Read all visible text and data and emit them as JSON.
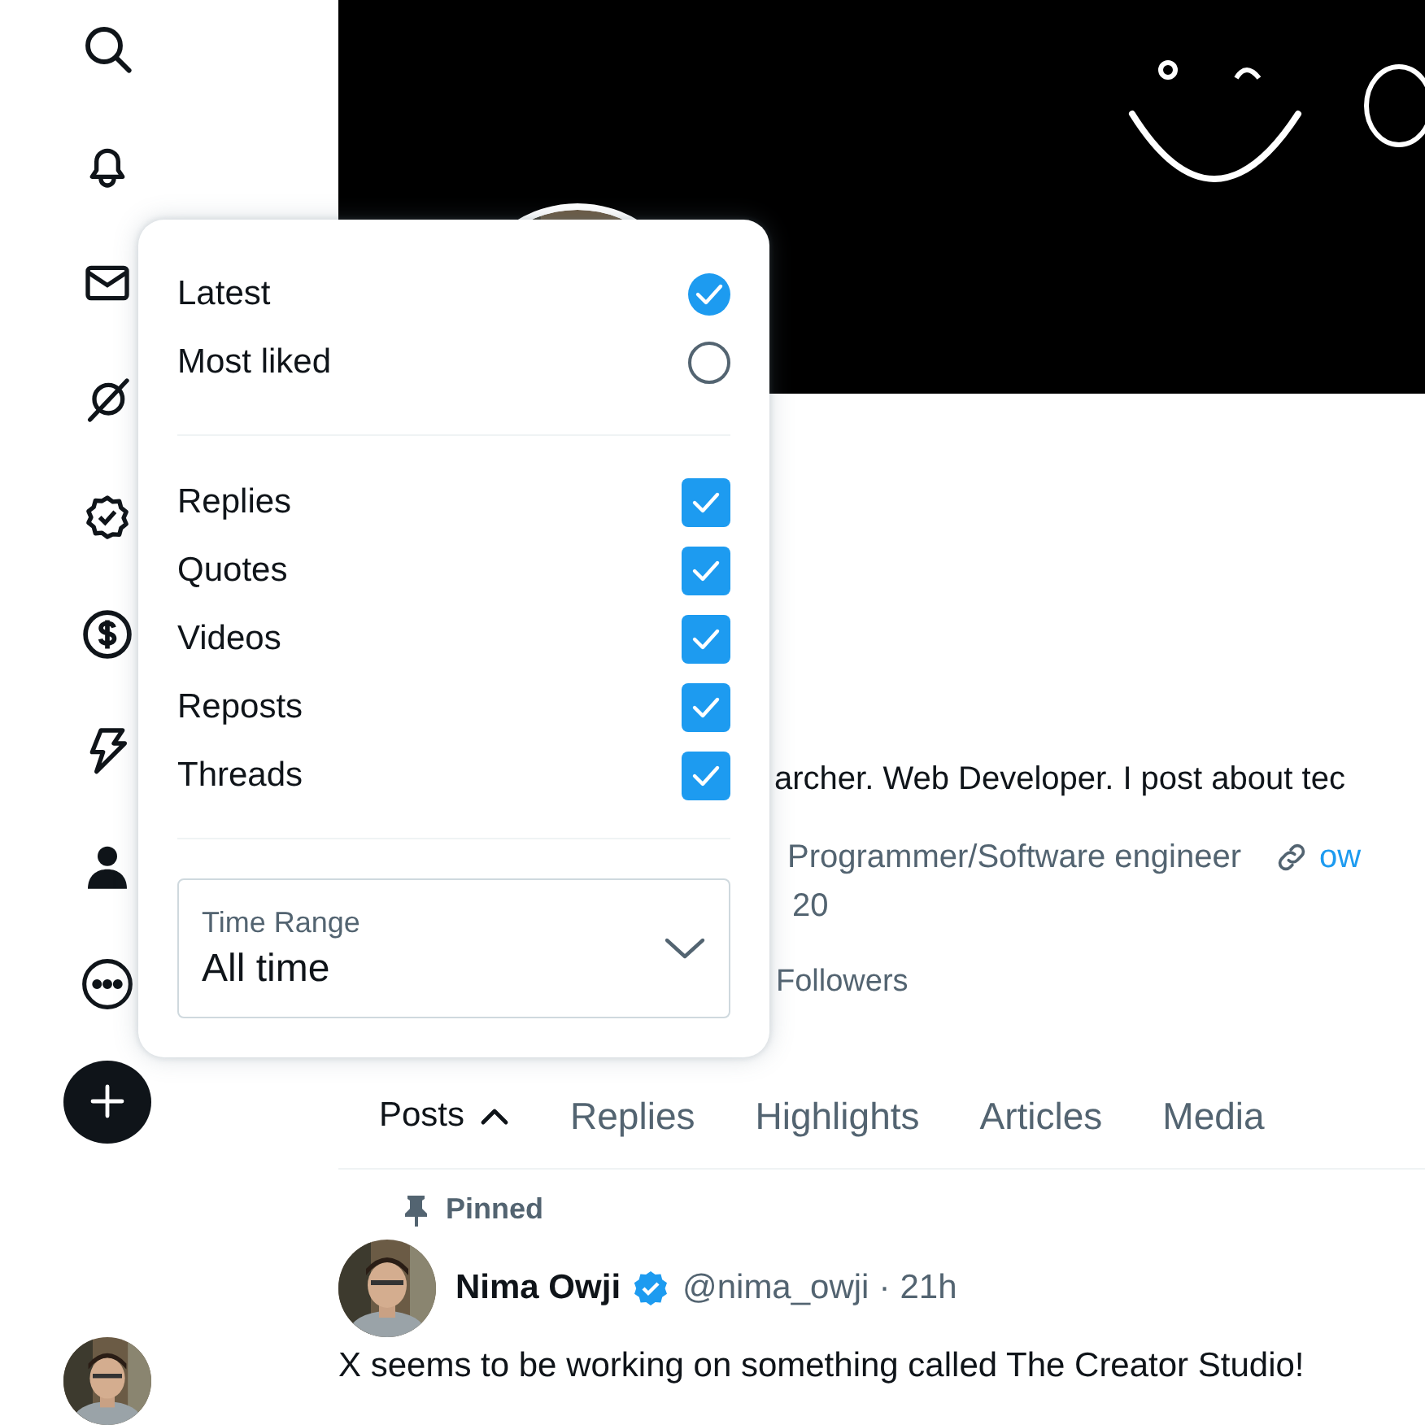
{
  "profile": {
    "bio": "archer. Web Developer. I post about tec",
    "profession": "Programmer/Software engineer",
    "link": "ow",
    "joined": "20",
    "followers": "Followers"
  },
  "tabs": [
    {
      "label": "Posts",
      "selected": true
    },
    {
      "label": "Replies",
      "selected": false
    },
    {
      "label": "Highlights",
      "selected": false
    },
    {
      "label": "Articles",
      "selected": false
    },
    {
      "label": "Media",
      "selected": false
    }
  ],
  "post": {
    "pinned": "Pinned",
    "author": "Nima Owji",
    "verified": true,
    "handle": "@nima_owji",
    "separator": "·",
    "time": "21h",
    "text": "X seems to be working on something called The Creator Studio!"
  },
  "menu": {
    "sort_options": [
      {
        "label": "Latest",
        "selected": true
      },
      {
        "label": "Most liked",
        "selected": false
      }
    ],
    "filters": [
      {
        "label": "Replies",
        "checked": true
      },
      {
        "label": "Quotes",
        "checked": true
      },
      {
        "label": "Videos",
        "checked": true
      },
      {
        "label": "Reposts",
        "checked": true
      },
      {
        "label": "Threads",
        "checked": true
      }
    ],
    "time_range": {
      "label": "Time Range",
      "value": "All time"
    }
  }
}
